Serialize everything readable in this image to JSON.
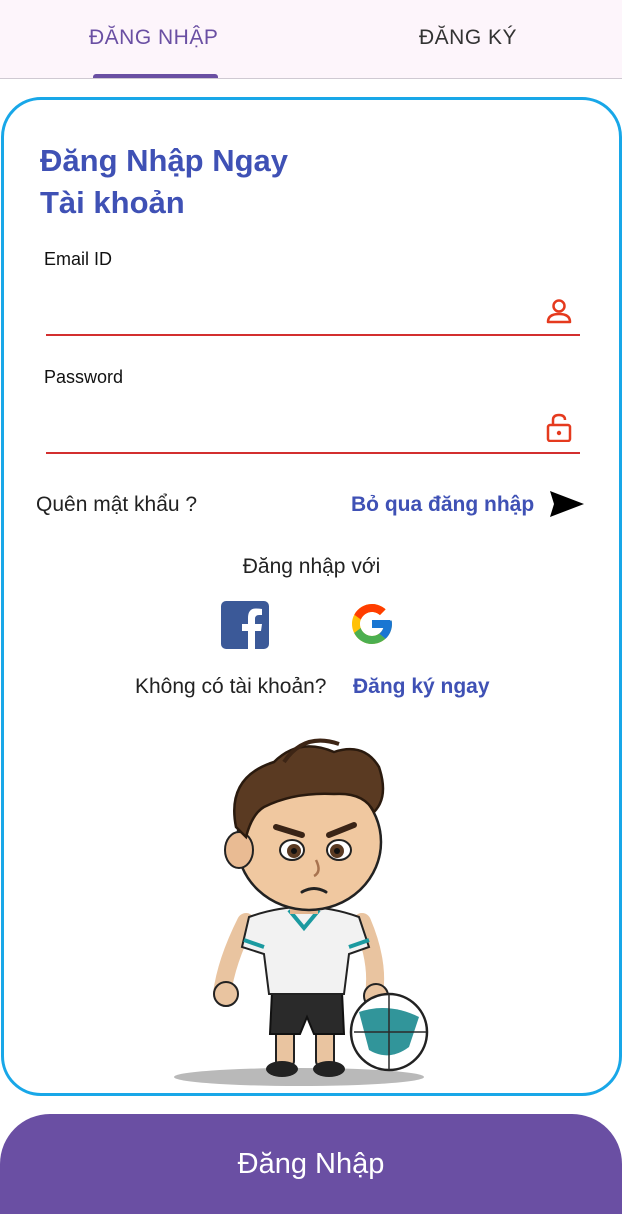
{
  "tabs": [
    {
      "label": "ĐĂNG NHẬP",
      "active": true
    },
    {
      "label": "ĐĂNG KÝ",
      "active": false
    }
  ],
  "card": {
    "heading_line1": "Đăng Nhập Ngay",
    "heading_line2": "Tài khoản",
    "email": {
      "label": "Email ID",
      "value": "",
      "icon": "person-icon"
    },
    "password": {
      "label": "Password",
      "value": "",
      "icon": "lock-icon"
    },
    "forgot_password": "Quên mật khẩu ?",
    "skip_login": "Bỏ qua đăng nhập",
    "login_with": "Đăng nhập với",
    "social": [
      "facebook-icon",
      "google-icon"
    ],
    "no_account": "Không có tài khoản?",
    "register_now": "Đăng ký ngay"
  },
  "login_button": "Đăng Nhập",
  "colors": {
    "accent": "#6a4fa3",
    "heading": "#3f51b5",
    "card_border": "#18a7e8",
    "field_line": "#d32f2f",
    "icon_red": "#e53a1e"
  }
}
